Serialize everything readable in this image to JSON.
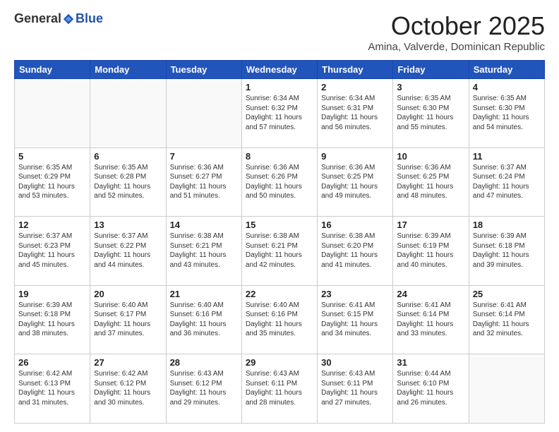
{
  "header": {
    "logo_general": "General",
    "logo_blue": "Blue",
    "month_title": "October 2025",
    "location": "Amina, Valverde, Dominican Republic"
  },
  "weekdays": [
    "Sunday",
    "Monday",
    "Tuesday",
    "Wednesday",
    "Thursday",
    "Friday",
    "Saturday"
  ],
  "weeks": [
    [
      {
        "day": "",
        "info": ""
      },
      {
        "day": "",
        "info": ""
      },
      {
        "day": "",
        "info": ""
      },
      {
        "day": "1",
        "info": "Sunrise: 6:34 AM\nSunset: 6:32 PM\nDaylight: 11 hours\nand 57 minutes."
      },
      {
        "day": "2",
        "info": "Sunrise: 6:34 AM\nSunset: 6:31 PM\nDaylight: 11 hours\nand 56 minutes."
      },
      {
        "day": "3",
        "info": "Sunrise: 6:35 AM\nSunset: 6:30 PM\nDaylight: 11 hours\nand 55 minutes."
      },
      {
        "day": "4",
        "info": "Sunrise: 6:35 AM\nSunset: 6:30 PM\nDaylight: 11 hours\nand 54 minutes."
      }
    ],
    [
      {
        "day": "5",
        "info": "Sunrise: 6:35 AM\nSunset: 6:29 PM\nDaylight: 11 hours\nand 53 minutes."
      },
      {
        "day": "6",
        "info": "Sunrise: 6:35 AM\nSunset: 6:28 PM\nDaylight: 11 hours\nand 52 minutes."
      },
      {
        "day": "7",
        "info": "Sunrise: 6:36 AM\nSunset: 6:27 PM\nDaylight: 11 hours\nand 51 minutes."
      },
      {
        "day": "8",
        "info": "Sunrise: 6:36 AM\nSunset: 6:26 PM\nDaylight: 11 hours\nand 50 minutes."
      },
      {
        "day": "9",
        "info": "Sunrise: 6:36 AM\nSunset: 6:25 PM\nDaylight: 11 hours\nand 49 minutes."
      },
      {
        "day": "10",
        "info": "Sunrise: 6:36 AM\nSunset: 6:25 PM\nDaylight: 11 hours\nand 48 minutes."
      },
      {
        "day": "11",
        "info": "Sunrise: 6:37 AM\nSunset: 6:24 PM\nDaylight: 11 hours\nand 47 minutes."
      }
    ],
    [
      {
        "day": "12",
        "info": "Sunrise: 6:37 AM\nSunset: 6:23 PM\nDaylight: 11 hours\nand 45 minutes."
      },
      {
        "day": "13",
        "info": "Sunrise: 6:37 AM\nSunset: 6:22 PM\nDaylight: 11 hours\nand 44 minutes."
      },
      {
        "day": "14",
        "info": "Sunrise: 6:38 AM\nSunset: 6:21 PM\nDaylight: 11 hours\nand 43 minutes."
      },
      {
        "day": "15",
        "info": "Sunrise: 6:38 AM\nSunset: 6:21 PM\nDaylight: 11 hours\nand 42 minutes."
      },
      {
        "day": "16",
        "info": "Sunrise: 6:38 AM\nSunset: 6:20 PM\nDaylight: 11 hours\nand 41 minutes."
      },
      {
        "day": "17",
        "info": "Sunrise: 6:39 AM\nSunset: 6:19 PM\nDaylight: 11 hours\nand 40 minutes."
      },
      {
        "day": "18",
        "info": "Sunrise: 6:39 AM\nSunset: 6:18 PM\nDaylight: 11 hours\nand 39 minutes."
      }
    ],
    [
      {
        "day": "19",
        "info": "Sunrise: 6:39 AM\nSunset: 6:18 PM\nDaylight: 11 hours\nand 38 minutes."
      },
      {
        "day": "20",
        "info": "Sunrise: 6:40 AM\nSunset: 6:17 PM\nDaylight: 11 hours\nand 37 minutes."
      },
      {
        "day": "21",
        "info": "Sunrise: 6:40 AM\nSunset: 6:16 PM\nDaylight: 11 hours\nand 36 minutes."
      },
      {
        "day": "22",
        "info": "Sunrise: 6:40 AM\nSunset: 6:16 PM\nDaylight: 11 hours\nand 35 minutes."
      },
      {
        "day": "23",
        "info": "Sunrise: 6:41 AM\nSunset: 6:15 PM\nDaylight: 11 hours\nand 34 minutes."
      },
      {
        "day": "24",
        "info": "Sunrise: 6:41 AM\nSunset: 6:14 PM\nDaylight: 11 hours\nand 33 minutes."
      },
      {
        "day": "25",
        "info": "Sunrise: 6:41 AM\nSunset: 6:14 PM\nDaylight: 11 hours\nand 32 minutes."
      }
    ],
    [
      {
        "day": "26",
        "info": "Sunrise: 6:42 AM\nSunset: 6:13 PM\nDaylight: 11 hours\nand 31 minutes."
      },
      {
        "day": "27",
        "info": "Sunrise: 6:42 AM\nSunset: 6:12 PM\nDaylight: 11 hours\nand 30 minutes."
      },
      {
        "day": "28",
        "info": "Sunrise: 6:43 AM\nSunset: 6:12 PM\nDaylight: 11 hours\nand 29 minutes."
      },
      {
        "day": "29",
        "info": "Sunrise: 6:43 AM\nSunset: 6:11 PM\nDaylight: 11 hours\nand 28 minutes."
      },
      {
        "day": "30",
        "info": "Sunrise: 6:43 AM\nSunset: 6:11 PM\nDaylight: 11 hours\nand 27 minutes."
      },
      {
        "day": "31",
        "info": "Sunrise: 6:44 AM\nSunset: 6:10 PM\nDaylight: 11 hours\nand 26 minutes."
      },
      {
        "day": "",
        "info": ""
      }
    ]
  ]
}
